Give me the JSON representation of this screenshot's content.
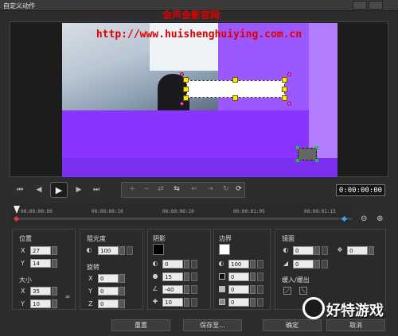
{
  "window": {
    "title": "自定义动作"
  },
  "watermark": {
    "line1": "会声会影官网",
    "line2": "http://www.huishenghuiying.com.cn"
  },
  "transport": {
    "timecode": "0:00:00:00"
  },
  "timeline": {
    "ticks": [
      "00:00:00:00",
      "00:00:00:10",
      "00:00:00:20",
      "00:00:01:05",
      "00:00:01:15"
    ]
  },
  "position": {
    "label": "位置",
    "x_label": "X",
    "x": "27",
    "y_label": "Y",
    "y": "14"
  },
  "size": {
    "label": "大小",
    "x_label": "X",
    "x": "35",
    "y_label": "Y",
    "y": "10"
  },
  "opacity": {
    "label": "阻光度",
    "value": "100"
  },
  "rotation": {
    "label": "旋转",
    "x_label": "X",
    "x": "0",
    "y_label": "Y",
    "y": "0",
    "z_label": "Z",
    "z": "0"
  },
  "shadow": {
    "label": "阴影",
    "color": "#000000",
    "v1": "0",
    "v2": "15",
    "v3": "-40",
    "v4": "10"
  },
  "border": {
    "label": "边界",
    "color": "#ffffff",
    "v1": "100",
    "v2": "0",
    "v3": "0",
    "v4": "0"
  },
  "mirror": {
    "label": "镜面",
    "v1": "0",
    "v2": "0",
    "v3": "0"
  },
  "fade": {
    "label": "缓入/缓出"
  },
  "footer": {
    "reset": "重置",
    "save_to": "保存至...",
    "ok": "确定",
    "cancel": "取消"
  },
  "site_logo": {
    "text": "好特游戏"
  },
  "colors": {
    "video_purple": "#8a35ff",
    "handle_yellow": "#ffe600",
    "handle_pink": "#ff4fd8",
    "watermark_red": "#e00000"
  }
}
